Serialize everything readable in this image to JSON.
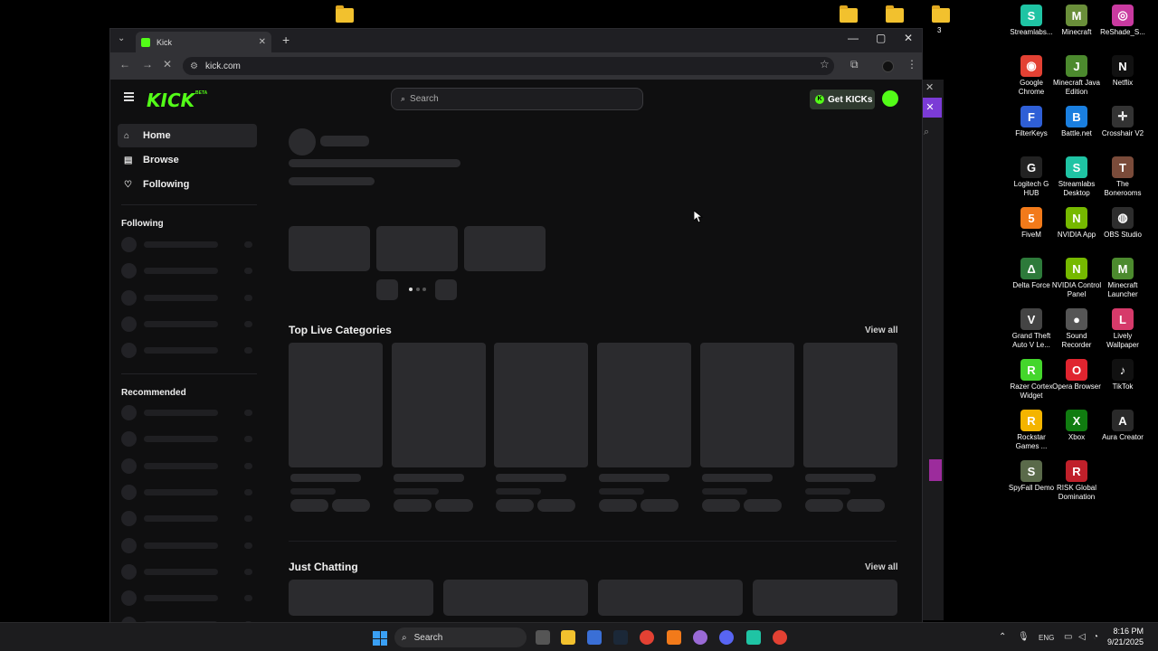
{
  "desktop": {
    "icons": [
      {
        "label": "Streamlabs...",
        "color": "#1fc4a4",
        "glyph": "S"
      },
      {
        "label": "Minecraft",
        "color": "#6a8f3a",
        "glyph": "M"
      },
      {
        "label": "ReShade_S...",
        "color": "#c93aa0",
        "glyph": "◎"
      },
      {
        "label": "Google Chrome",
        "color": "#e34133",
        "glyph": "◉"
      },
      {
        "label": "Minecraft Java Edition",
        "color": "#4c8a2e",
        "glyph": "J"
      },
      {
        "label": "Netflix",
        "color": "#111111",
        "glyph": "N"
      },
      {
        "label": "FilterKeys",
        "color": "#2f5fd6",
        "glyph": "F"
      },
      {
        "label": "Battle.net",
        "color": "#1a7fe0",
        "glyph": "B"
      },
      {
        "label": "Crosshair V2",
        "color": "#333333",
        "glyph": "✛"
      },
      {
        "label": "Logitech G HUB",
        "color": "#222222",
        "glyph": "G"
      },
      {
        "label": "Streamlabs Desktop",
        "color": "#1fc4a4",
        "glyph": "S"
      },
      {
        "label": "The Bonerooms",
        "color": "#7a4b3a",
        "glyph": "T"
      },
      {
        "label": "FiveM",
        "color": "#f27a1a",
        "glyph": "5"
      },
      {
        "label": "NVIDIA App",
        "color": "#76b900",
        "glyph": "N"
      },
      {
        "label": "OBS Studio",
        "color": "#2d2d2d",
        "glyph": "◍"
      },
      {
        "label": "Delta Force",
        "color": "#2d7a3a",
        "glyph": "Δ"
      },
      {
        "label": "NVIDIA Control Panel",
        "color": "#76b900",
        "glyph": "N"
      },
      {
        "label": "Minecraft Launcher",
        "color": "#4c8a2e",
        "glyph": "M"
      },
      {
        "label": "Grand Theft Auto V Le...",
        "color": "#444444",
        "glyph": "V"
      },
      {
        "label": "Sound Recorder",
        "color": "#555555",
        "glyph": "●"
      },
      {
        "label": "Lively Wallpaper",
        "color": "#d63a6a",
        "glyph": "L"
      },
      {
        "label": "Razer Cortex Widget",
        "color": "#44d62c",
        "glyph": "R"
      },
      {
        "label": "Opera Browser",
        "color": "#e0242f",
        "glyph": "O"
      },
      {
        "label": "TikTok",
        "color": "#111111",
        "glyph": "♪"
      },
      {
        "label": "Rockstar Games ...",
        "color": "#f4b400",
        "glyph": "R"
      },
      {
        "label": "Xbox",
        "color": "#107c10",
        "glyph": "X"
      },
      {
        "label": "Aura Creator",
        "color": "#2a2a2a",
        "glyph": "A"
      },
      {
        "label": "SpyFall Demo",
        "color": "#5a6a4a",
        "glyph": "S"
      },
      {
        "label": "RISK Global Domination",
        "color": "#c0202a",
        "glyph": "R"
      }
    ],
    "folder_label_3": "3",
    "bg_window_close": "✕",
    "bg_window_x": "✕",
    "bg_window_search": "⌕"
  },
  "browser": {
    "tab_title": "Kick",
    "tab_close": "✕",
    "new_tab": "+",
    "tab_list": "⌄",
    "url": "kick.com",
    "minimize": "—",
    "maximize": "▢",
    "close": "✕",
    "back": "←",
    "forward": "→",
    "reload": "✕",
    "site_info": "⚙",
    "bookmark": "☆",
    "extensions": "⧉",
    "menu": "⋮"
  },
  "kick": {
    "logo": "KICK",
    "logo_badge": "BETA",
    "search_placeholder": "Search",
    "search_icon": "⌕",
    "get_kicks": "Get KICKs",
    "get_kicks_icon": "K",
    "nav": [
      {
        "label": "Home",
        "icon": "⌂",
        "active": true
      },
      {
        "label": "Browse",
        "icon": "▤",
        "active": false
      },
      {
        "label": "Following",
        "icon": "♡",
        "active": false
      }
    ],
    "following_heading": "Following",
    "recommended_heading": "Recommended",
    "top_live_categories": "Top Live Categories",
    "just_chatting": "Just Chatting",
    "view_all": "View all"
  },
  "taskbar": {
    "search_label": "Search",
    "search_icon": "⌕",
    "tray_chevron": "⌃",
    "mic": "🎙",
    "lang": "ENG",
    "time": "8:16 PM",
    "date": "9/21/2025"
  }
}
